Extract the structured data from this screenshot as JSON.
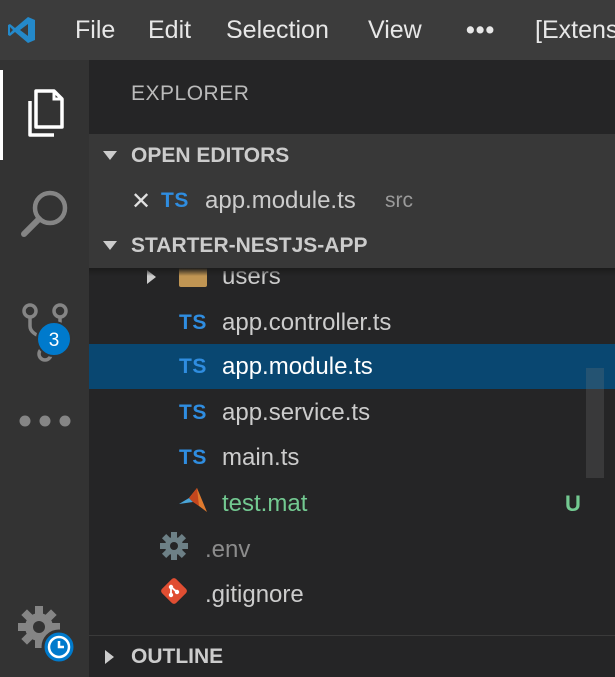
{
  "titlebar": {
    "menu": [
      "File",
      "Edit",
      "Selection",
      "View"
    ],
    "more": "•••",
    "window_title": "[Extension Development Host]",
    "icons": {
      "app": "vscode-logo-icon"
    }
  },
  "activitybar": {
    "items": [
      {
        "name": "explorer",
        "icon": "files-icon",
        "active": true
      },
      {
        "name": "search",
        "icon": "search-icon"
      },
      {
        "name": "source-control",
        "icon": "source-control-icon",
        "badge": "3"
      },
      {
        "name": "more",
        "icon": "ellipsis-icon"
      },
      {
        "name": "manage",
        "icon": "gear-icon",
        "overlay": "clock-icon"
      }
    ]
  },
  "sidebar": {
    "title": "EXPLORER",
    "open_editors": {
      "header": "OPEN EDITORS",
      "items": [
        {
          "close": "✕",
          "type": "TS",
          "name": "app.module.ts",
          "description": "src"
        }
      ]
    },
    "project": {
      "header": "STARTER-NESTJS-APP",
      "rows": [
        {
          "type": "folder",
          "name": "users"
        },
        {
          "type": "TS",
          "name": "app.controller.ts"
        },
        {
          "type": "TS",
          "name": "app.module.ts",
          "selected": true
        },
        {
          "type": "TS",
          "name": "app.service.ts"
        },
        {
          "type": "TS",
          "name": "main.ts"
        },
        {
          "type": "matlab",
          "name": "test.mat",
          "status": "U"
        },
        {
          "type": "gear",
          "name": ".env"
        },
        {
          "type": "git",
          "name": ".gitignore"
        }
      ]
    },
    "outline": {
      "header": "OUTLINE"
    }
  },
  "colors": {
    "titlebar": "#3c3c3c",
    "activitybar": "#333333",
    "sidebar": "#252526",
    "selection": "#094771",
    "ts_icon": "#2f8de0",
    "untracked": "#73c991",
    "badge": "#007acc"
  }
}
